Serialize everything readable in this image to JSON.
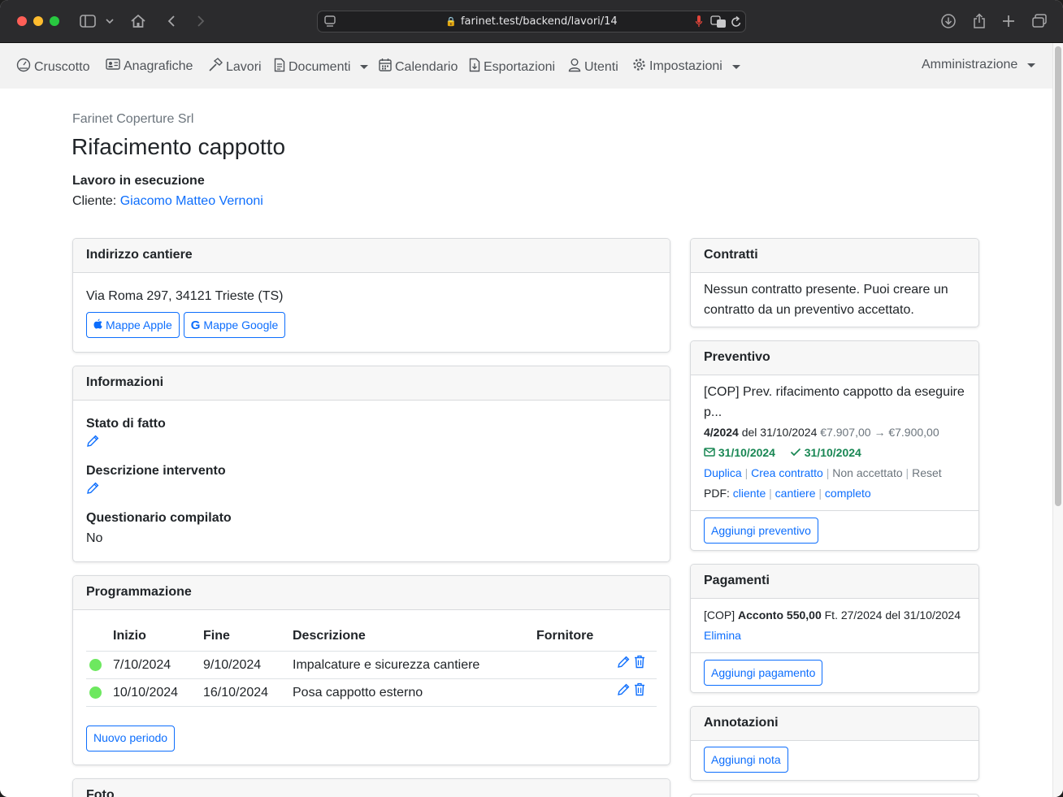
{
  "browser": {
    "url": "farinet.test/backend/lavori/14"
  },
  "navbar": {
    "items": [
      {
        "label": "Cruscotto",
        "icon": "dashboard-icon"
      },
      {
        "label": "Anagrafiche",
        "icon": "id-card-icon"
      },
      {
        "label": "Lavori",
        "icon": "hammer-icon"
      },
      {
        "label": "Documenti",
        "icon": "document-icon"
      },
      {
        "label": "Calendario",
        "icon": "calendar-icon"
      },
      {
        "label": "Esportazioni",
        "icon": "export-file-icon"
      },
      {
        "label": "Utenti",
        "icon": "user-icon"
      },
      {
        "label": "Impostazioni",
        "icon": "gear-icon"
      }
    ],
    "admin": "Amministrazione"
  },
  "header": {
    "company": "Farinet Coperture Srl",
    "title": "Rifacimento cappotto",
    "status": "Lavoro in esecuzione",
    "client_label": "Cliente:",
    "client_name": "Giacomo Matteo Vernoni"
  },
  "address_card": {
    "title": "Indirizzo cantiere",
    "address": "Via Roma 297, 34121 Trieste (TS)",
    "apple_maps": "Mappe Apple",
    "google_maps": "Mappe Google"
  },
  "info_card": {
    "title": "Informazioni",
    "stato_label": "Stato di fatto",
    "descrizione_label": "Descrizione intervento",
    "questionario_label": "Questionario compilato",
    "questionario_value": "No"
  },
  "schedule_card": {
    "title": "Programmazione",
    "columns": [
      "Inizio",
      "Fine",
      "Descrizione",
      "Fornitore"
    ],
    "rows": [
      {
        "start": "7/10/2024",
        "end": "9/10/2024",
        "description": "Impalcature e sicurezza cantiere",
        "supplier": ""
      },
      {
        "start": "10/10/2024",
        "end": "16/10/2024",
        "description": "Posa cappotto esterno",
        "supplier": ""
      }
    ],
    "new_button": "Nuovo periodo"
  },
  "photo_card": {
    "title": "Foto"
  },
  "contracts_card": {
    "title": "Contratti",
    "text": "Nessun contratto presente. Puoi creare un contratto da un preventivo accettato."
  },
  "quote_card": {
    "title": "Preventivo",
    "description": "[COP] Prev. rifacimento cappotto da eseguire p...",
    "number": "4/2024",
    "date_prefix": "del 31/10/2024",
    "amount_old": "€7.907,00",
    "amount_new": "€7.900,00",
    "sent_date": "31/10/2024",
    "accepted_date": "31/10/2024",
    "actions": [
      "Duplica",
      "Crea contratto",
      "Non accettato",
      "Reset"
    ],
    "pdf_label": "PDF:",
    "pdf_links": [
      "cliente",
      "cantiere",
      "completo"
    ],
    "add_button": "Aggiungi preventivo"
  },
  "payments_card": {
    "title": "Pagamenti",
    "prefix": "[COP]",
    "payment": "Acconto 550,00",
    "detail": "Ft. 27/2024 del 31/10/2024",
    "delete_link": "Elimina",
    "add_button": "Aggiungi pagamento"
  },
  "notes_card": {
    "title": "Annotazioni",
    "add_button": "Aggiungi nota"
  },
  "colors": {
    "primary": "#0d6efd",
    "success": "#198754",
    "status_dot": "#6de85f"
  }
}
